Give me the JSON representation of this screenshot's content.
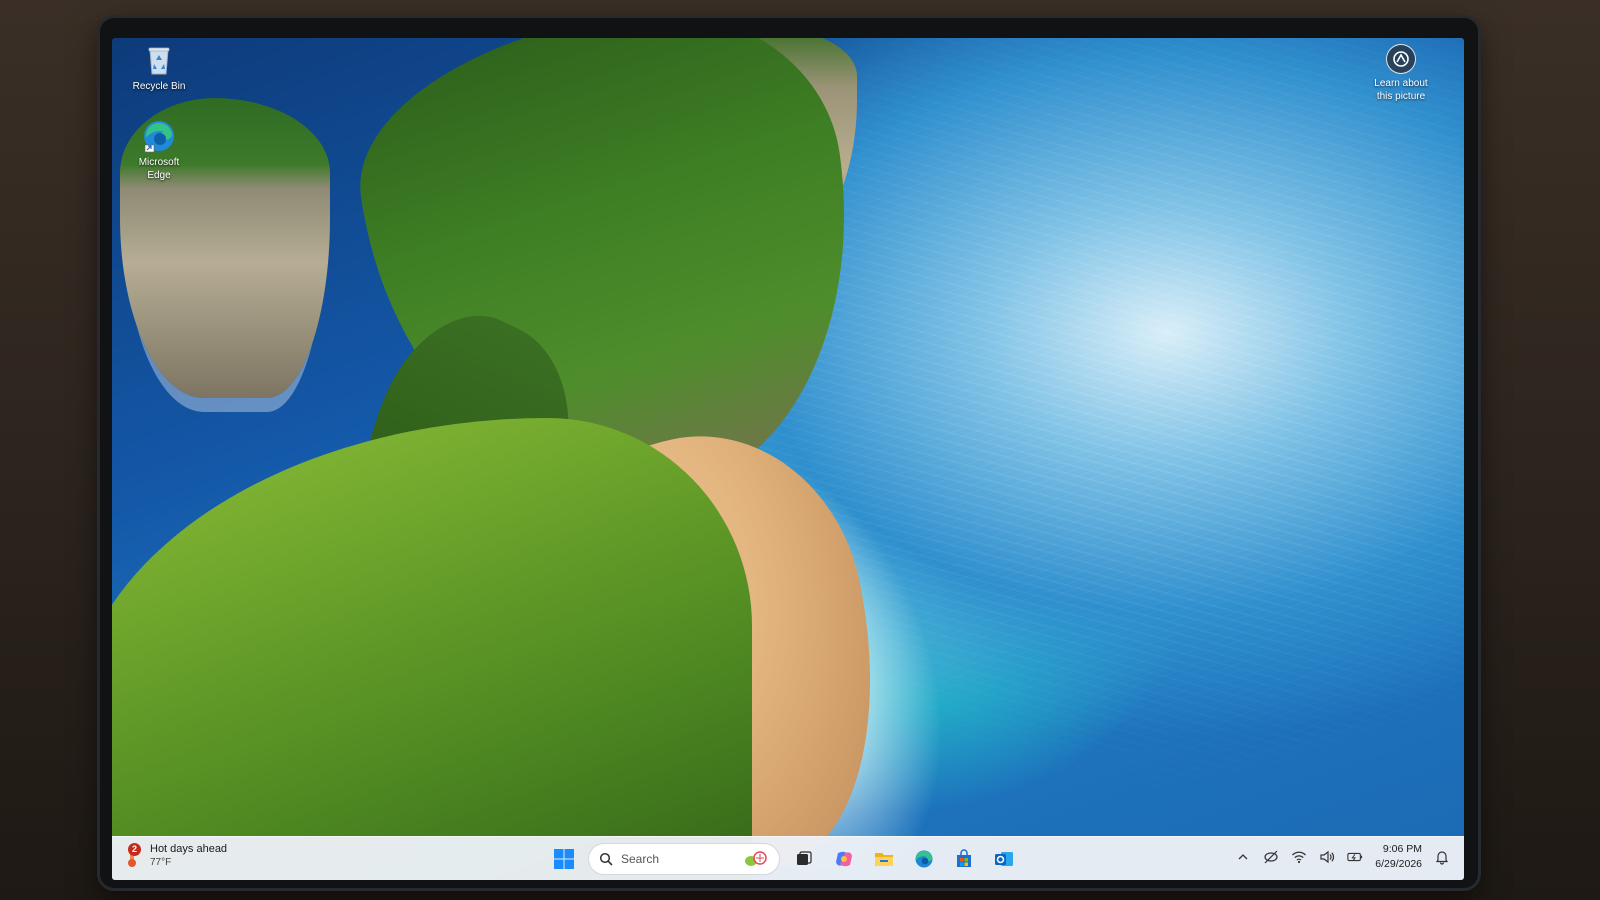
{
  "desktop": {
    "icons": [
      {
        "name": "recycle-bin",
        "label": "Recycle Bin"
      },
      {
        "name": "microsoft-edge",
        "label_line1": "Microsoft",
        "label_line2": "Edge"
      }
    ],
    "learn_about": {
      "line1": "Learn about",
      "line2": "this picture"
    }
  },
  "taskbar": {
    "weather": {
      "badge_count": "2",
      "headline": "Hot days ahead",
      "temperature": "77°F"
    },
    "search": {
      "placeholder": "Search"
    },
    "pinned": [
      "start-icon",
      "search",
      "task-view-icon",
      "copilot-icon",
      "file-explorer-icon",
      "edge-icon",
      "microsoft-store-icon",
      "outlook-icon"
    ],
    "tray": {
      "icons": [
        "chevron-up-icon",
        "meet-now-icon",
        "wifi-icon",
        "volume-icon",
        "battery-icon"
      ],
      "time": "9:06 PM",
      "date": "6/29/2026"
    }
  },
  "colors": {
    "taskbar_bg": "#ECF0F6",
    "accent_blue": "#0078D4",
    "badge_red": "#C42B1C"
  }
}
